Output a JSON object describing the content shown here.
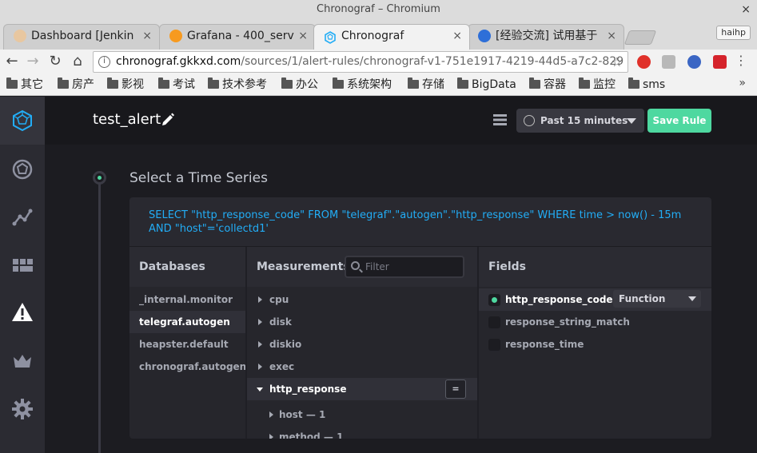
{
  "window": {
    "title": "Chronograf – Chromium",
    "close_glyph": "×"
  },
  "tabs": [
    {
      "label": "Dashboard [Jenkin",
      "icon": "jenkins-icon",
      "color": "#d24939"
    },
    {
      "label": "Grafana - 400_serv",
      "icon": "grafana-icon",
      "color": "#f79a1f"
    },
    {
      "label": "Chronograf",
      "icon": "chronograf-icon",
      "color": "#22adf6"
    },
    {
      "label": "[经验交流] 试用基于",
      "icon": "forum-icon",
      "color": "#2e6fd8"
    }
  ],
  "tab_close_glyph": "×",
  "profile_badge": "haihp",
  "address_bar": {
    "host": "chronograf.gkkxd.com",
    "path": "/sources/1/alert-rules/chronograf-v1-751e1917-4219-44d5-a7c2-829"
  },
  "nav": {
    "back": "←",
    "forward": "→",
    "reload": "↻",
    "home": "⌂",
    "star": "☆",
    "menu": "⋮"
  },
  "bookmarks": [
    "其它",
    "房产",
    "影视",
    "考试",
    "技术参考",
    "办公",
    "系统架构",
    "存储",
    "BigData",
    "容器",
    "监控",
    "sms"
  ],
  "bookmarks_more": "»",
  "sidebar": {
    "icons": [
      "chronograf-logo-icon",
      "host-graph-icon",
      "data-explorer-icon",
      "dashboards-icon",
      "alert-icon",
      "admin-crown-icon",
      "settings-gear-icon"
    ],
    "active": "alert-icon"
  },
  "header": {
    "title": "test_alert",
    "time_range": "Past 15 minutes",
    "save_label": "Save Rule"
  },
  "section": {
    "title": "Select a Time Series"
  },
  "query": {
    "line1": "SELECT \"http_response_code\" FROM \"telegraf\".\"autogen\".\"http_response\" WHERE time > now() - 15m",
    "line2": "AND \"host\"='collectd1'"
  },
  "databases": {
    "header": "Databases",
    "items": [
      "_internal.monitor",
      "telegraf.autogen",
      "heapster.default",
      "chronograf.autogen"
    ],
    "selected": "telegraf.autogen"
  },
  "measurements": {
    "header": "Measurements",
    "filter_placeholder": "Filter",
    "items": [
      "cpu",
      "disk",
      "diskio",
      "exec",
      "http_response"
    ],
    "expanded": "http_response",
    "group_by_label": "=",
    "tags": [
      "host — 1",
      "method — 1"
    ]
  },
  "fields": {
    "header": "Fields",
    "items": [
      "http_response_code",
      "response_string_match",
      "response_time"
    ],
    "selected": "http_response_code",
    "function_label": "Function"
  },
  "colors": {
    "accent": "#4ed8a0",
    "query": "#22adf6"
  }
}
